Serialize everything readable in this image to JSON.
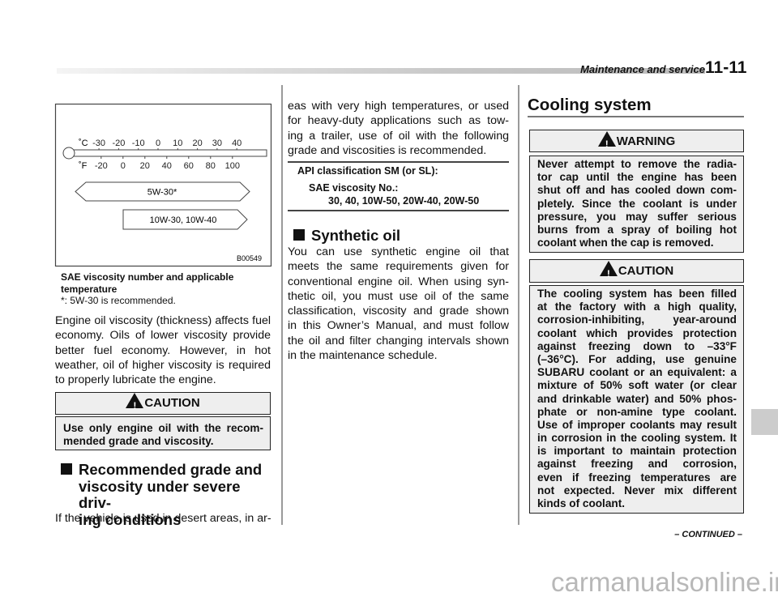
{
  "header": {
    "section": "Maintenance and service",
    "page": "11-11"
  },
  "figure": {
    "celsius_label": "˚C",
    "fahrenheit_label": "˚F",
    "celsius_ticks": [
      "-30",
      "-20",
      "-10",
      "0",
      "10",
      "20",
      "30",
      "40"
    ],
    "fahrenheit_ticks": [
      "-20",
      "0",
      "20",
      "40",
      "60",
      "80",
      "100"
    ],
    "grade_1": "5W-30*",
    "grade_2": "10W-30, 10W-40",
    "code": "B00549",
    "caption_1": "SAE viscosity number and applicable",
    "caption_2": "temperature",
    "footnote": "*:   5W-30 is recommended."
  },
  "left": {
    "para1": [
      "Engine oil viscosity (thickness) affects fuel",
      "economy. Oils of lower viscosity provide",
      "better fuel economy. However, in hot",
      "weather, oil of higher viscosity is required",
      "to properly lubricate the engine."
    ],
    "caution_title": "CAUTION",
    "caution_lines": [
      "Use only engine oil with the recom-",
      "mended grade and viscosity."
    ],
    "heading_lines": [
      "Recommended grade and",
      "viscosity under severe driv-",
      "ing conditions"
    ],
    "para2": [
      "If the vehicle is used in desert areas, in ar-"
    ]
  },
  "middle": {
    "para1": [
      "eas with very high temperatures, or used",
      "for heavy-duty applications such as tow-",
      "ing a trailer, use of oil with the following",
      "grade and viscosities is recommended."
    ],
    "api": "API classification SM (or SL):",
    "sae_label": "SAE viscosity No.:",
    "sae_values": "30, 40, 10W-50, 20W-40, 20W-50",
    "heading": "Synthetic oil",
    "para2": [
      "You can use synthetic engine oil that",
      "meets the same requirements given for",
      "conventional engine oil. When using syn-",
      "thetic oil, you must use oil of the same",
      "classification, viscosity and grade shown",
      "in this Owner’s Manual, and must follow",
      "the oil and filter changing intervals shown",
      "in the maintenance schedule."
    ]
  },
  "right": {
    "heading": "Cooling system",
    "warning_title": "WARNING",
    "warning_lines": [
      "Never attempt to remove the radia-",
      "tor cap until the engine has been",
      "shut off and has cooled down com-",
      "pletely. Since the coolant is under",
      "pressure, you may suffer serious",
      "burns from a spray of boiling hot",
      "coolant when the cap is removed."
    ],
    "caution_title": "CAUTION",
    "caution_lines": [
      "The cooling system has been filled",
      "at the factory with a high quality,",
      "corrosion-inhibiting, year-around",
      "coolant which provides protection",
      "against freezing down to –33°F",
      "(–36°C). For adding, use genuine",
      "SUBARU coolant or an equivalent: a",
      "mixture of 50% soft water (or clear",
      "and drinkable water) and 50% phos-",
      "phate or non-amine type coolant.",
      "Use of improper coolants may result",
      "in corrosion in the cooling system. It",
      "is important to maintain protection",
      "against freezing and corrosion,",
      "even if freezing temperatures are",
      "not expected. Never mix different",
      "kinds of coolant."
    ]
  },
  "footer": {
    "continued": "– CONTINUED –",
    "watermark": "carmanualsonline.info"
  },
  "colors": {
    "box_fill": "#eeeeee",
    "tab": "#cccccc"
  }
}
